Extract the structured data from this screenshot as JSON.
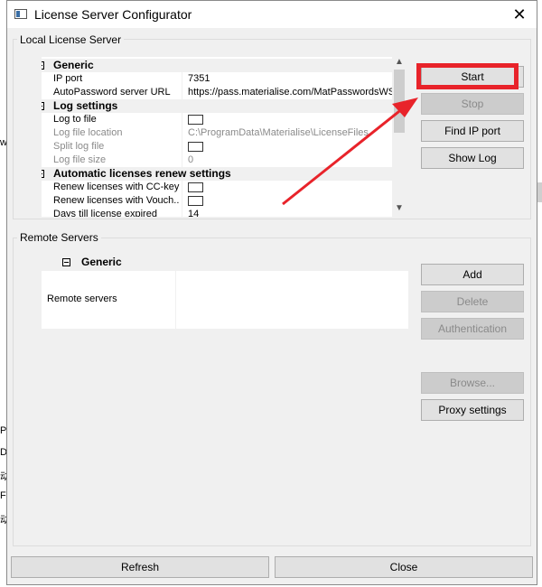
{
  "window": {
    "title": "License Server Configurator"
  },
  "background_fragments": [
    "w",
    "P",
    "D",
    "动",
    "F:",
    "动"
  ],
  "local": {
    "group_label": "Local License Server",
    "rows": [
      {
        "type": "cat",
        "label": "Generic"
      },
      {
        "type": "prop",
        "key": "IP port",
        "value": "7351"
      },
      {
        "type": "prop",
        "key": "AutoPassword server URL",
        "value": "https://pass.materialise.com/MatPasswordsWS/M"
      },
      {
        "type": "cat",
        "label": "Log settings"
      },
      {
        "type": "prop",
        "key": "Log to file",
        "checkbox": true
      },
      {
        "type": "prop",
        "key": "Log file location",
        "value": "C:\\ProgramData\\Materialise\\LicenseFiles",
        "dim": true
      },
      {
        "type": "prop",
        "key": "Split log file",
        "checkbox": true,
        "dim": true
      },
      {
        "type": "prop",
        "key": "Log file size",
        "value": "0",
        "dim": true
      },
      {
        "type": "cat",
        "label": "Automatic licenses renew settings"
      },
      {
        "type": "prop",
        "key": "Renew licenses with CC-key",
        "checkbox": true
      },
      {
        "type": "prop",
        "key": "Renew licenses with Vouch...",
        "checkbox": true
      },
      {
        "type": "prop",
        "key": "Days till license expired",
        "value": "14"
      }
    ],
    "buttons": {
      "start": "Start",
      "stop": "Stop",
      "find_ip": "Find IP port",
      "show_log": "Show Log"
    }
  },
  "remote": {
    "group_label": "Remote Servers",
    "category": "Generic",
    "row_key": "Remote servers",
    "row_value": "",
    "buttons": {
      "add": "Add",
      "delete": "Delete",
      "authentication": "Authentication",
      "browse": "Browse...",
      "proxy": "Proxy settings"
    }
  },
  "footer": {
    "refresh": "Refresh",
    "close": "Close"
  },
  "colors": {
    "annotation_red": "#e8232a",
    "window_bg": "#f0f0f0"
  },
  "icons": {
    "close": "close-icon",
    "app": "app-window-icon",
    "collapse": "collapse-minus-icon"
  }
}
